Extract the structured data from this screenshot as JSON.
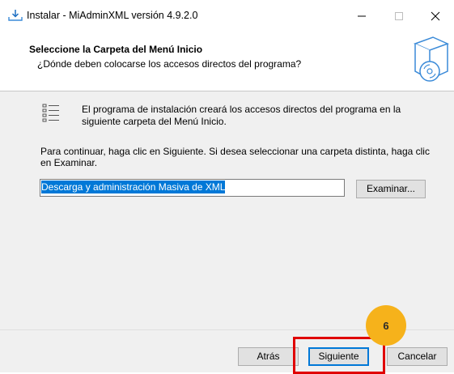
{
  "window": {
    "title": "Instalar - MiAdminXML versión 4.9.2.0",
    "controls": {
      "minimize": "—",
      "maximize": "☐",
      "close": "✕"
    }
  },
  "header": {
    "title": "Seleccione la Carpeta del Menú Inicio",
    "subtitle": "¿Dónde deben colocarse los accesos directos del programa?",
    "icon": "installer-disc-box-icon"
  },
  "body": {
    "info_icon": "start-menu-list-icon",
    "info_text": "El programa de instalación creará los accesos directos del programa en la siguiente carpeta del Menú Inicio.",
    "instruction": "Para continuar, haga clic en Siguiente. Si desea seleccionar una carpeta distinta, haga clic en Examinar.",
    "folder_value": "Descarga y administración Masiva de XML",
    "browse_label": "Examinar..."
  },
  "buttons": {
    "back": "Atrás",
    "next": "Siguiente",
    "cancel": "Cancelar"
  },
  "annotation": {
    "step": "6",
    "badge_color": "#f6b21b",
    "highlight_color": "#e00000"
  },
  "colors": {
    "accent": "#0078d7"
  }
}
